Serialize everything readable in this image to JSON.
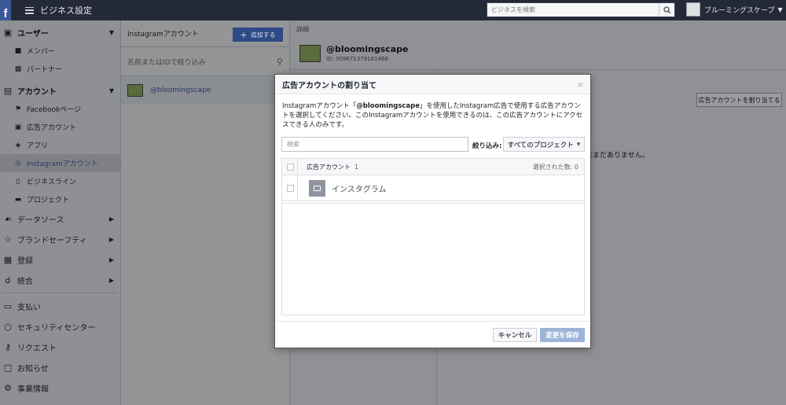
{
  "topbar": {
    "logo": "f",
    "title": "ビジネス設定",
    "search_placeholder": "ビジネスを検索",
    "user_name": "ブルーミングスケープ",
    "user_caret": "▼"
  },
  "sidebar": {
    "users_section": "ユーザー",
    "members": "メンバー",
    "partners": "パートナー",
    "accounts_section": "アカウント",
    "facebook_pages": "Facebookページ",
    "ad_accounts": "広告アカウント",
    "apps": "アプリ",
    "instagram_accounts": "Instagramアカウント",
    "business_lines": "ビジネスライン",
    "projects": "プロジェクト",
    "data_sources": "データソース",
    "brand_safety": "ブランドセーフティ",
    "registration": "登録",
    "integration": "統合",
    "payments": "支払い",
    "security_center": "セキュリティセンター",
    "requests": "リクエスト",
    "notifications": "お知らせ",
    "business_info": "事業情報"
  },
  "col2": {
    "title": "Instagramアカウント",
    "add_button": "追加する",
    "search_placeholder": "名前またはIDで絞り込み",
    "item": "@bloomingscape"
  },
  "col3": {
    "details_label": "詳細",
    "account_name": "@bloomingscape",
    "account_id": "ID: 309671379161468",
    "assign_button": "広告アカウントを割り当てる",
    "message": "ァウントに割り当てられた広告アカウントはまだありません。"
  },
  "modal": {
    "title": "広告アカウントの割り当て",
    "close": "×",
    "desc_pre": "Instagramアカウント「",
    "desc_account": "@bloomingscape",
    "desc_post": "」を使用したInstagram広告で使用する広告アカウントを選択してください。このInstagramアカウントを使用できるのは、この広告アカウントにアクセスできる人のみです。",
    "search_placeholder": "検索",
    "filter_label": "絞り込み:",
    "filter_value": "すべてのプロジェクト",
    "filter_caret": "▾",
    "table_header": "広告アカウント",
    "table_count": "1",
    "selected_count": "選択された数: 0",
    "rows": [
      {
        "label": "インスタグラム"
      }
    ],
    "cancel": "キャンセル",
    "save": "変更を保存"
  },
  "colors": {
    "topbar": "#232937",
    "primary": "#3b5998",
    "save_disabled": "#9cb4d8"
  }
}
